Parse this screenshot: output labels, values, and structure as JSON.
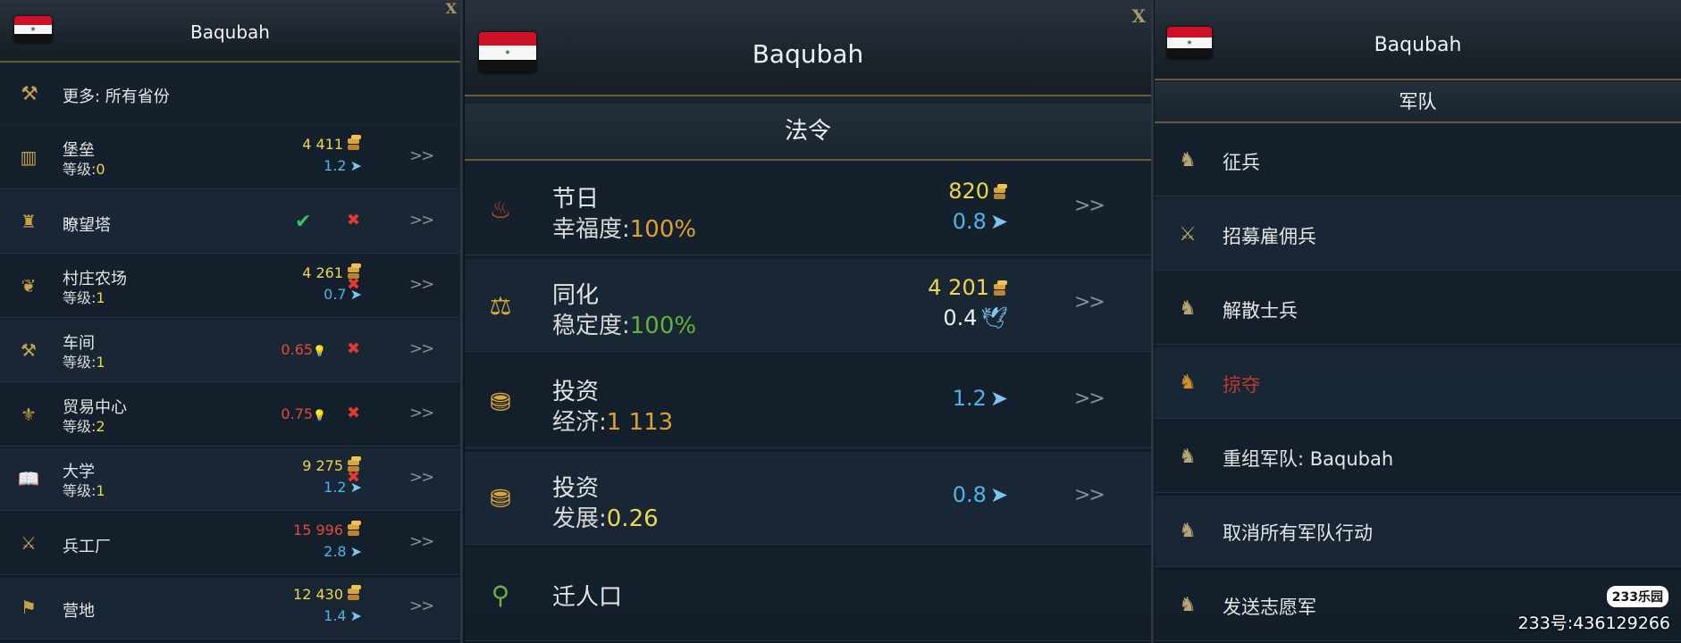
{
  "panel_left": {
    "title": "Baqubah",
    "close": "X",
    "more_link": "更多: 所有省份",
    "buildings": [
      {
        "name": "堡垒",
        "level_label": "等级:",
        "level": "0",
        "cost": "4 411",
        "cost_color": "gold",
        "rate": "1.2",
        "status": "none"
      },
      {
        "name": "瞭望塔",
        "level_label": "",
        "level": "",
        "cost": "",
        "cost_color": "",
        "rate": "",
        "status": "check"
      },
      {
        "name": "村庄农场",
        "level_label": "等级:",
        "level": "1",
        "cost": "4 261",
        "cost_color": "gold",
        "rate": "0.7",
        "status": "x"
      },
      {
        "name": "车间",
        "level_label": "等级:",
        "level": "1",
        "cost": "0.65",
        "cost_color": "red",
        "rate": "",
        "status": "x"
      },
      {
        "name": "贸易中心",
        "level_label": "等级:",
        "level": "2",
        "cost": "0.75",
        "cost_color": "red",
        "rate": "",
        "status": "x"
      },
      {
        "name": "大学",
        "level_label": "等级:",
        "level": "1",
        "cost": "9 275",
        "cost_color": "gold",
        "rate": "1.2",
        "status": "x"
      },
      {
        "name": "兵工厂",
        "level_label": "",
        "level": "",
        "cost": "15 996",
        "cost_color": "red",
        "rate": "2.8",
        "status": "none"
      },
      {
        "name": "营地",
        "level_label": "",
        "level": "",
        "cost": "12 430",
        "cost_color": "gold",
        "rate": "1.4",
        "status": "none"
      }
    ],
    "arrow": ">>"
  },
  "panel_mid": {
    "title": "Baqubah",
    "close": "X",
    "section": "法令",
    "decrees": [
      {
        "name": "节日",
        "stat_label": "幸福度:",
        "stat_value": "100%",
        "stat_color": "orange",
        "cost": "820",
        "rate": "0.8",
        "rate_color": "blue"
      },
      {
        "name": "同化",
        "stat_label": "稳定度:",
        "stat_value": "100%",
        "stat_color": "green",
        "cost": "4 201",
        "rate": "0.4",
        "rate_color": "white"
      },
      {
        "name": "投资",
        "stat_label": "经济:",
        "stat_value": "1 113",
        "stat_color": "orange",
        "cost": "",
        "rate": "1.2",
        "rate_color": "blue"
      },
      {
        "name": "投资",
        "stat_label": "发展:",
        "stat_value": "0.26",
        "stat_color": "gold",
        "cost": "",
        "rate": "0.8",
        "rate_color": "blue"
      },
      {
        "name": "迁人口",
        "stat_label": "",
        "stat_value": "",
        "stat_color": "",
        "cost": "",
        "rate": "",
        "rate_color": ""
      }
    ],
    "arrow": ">>"
  },
  "panel_right": {
    "title": "Baqubah",
    "section": "军队",
    "actions": [
      {
        "label": "征兵",
        "disabled": false
      },
      {
        "label": "招募雇佣兵",
        "disabled": false
      },
      {
        "label": "解散士兵",
        "disabled": false
      },
      {
        "label": "掠夺",
        "disabled": true
      },
      {
        "label": "重组军队: Baqubah",
        "disabled": false
      },
      {
        "label": "取消所有军队行动",
        "disabled": false
      },
      {
        "label": "发送志愿军",
        "disabled": false
      }
    ]
  },
  "watermark": {
    "logo": "233乐园",
    "text": "233号:436129266"
  },
  "colors": {
    "gold": "#f0d64a",
    "red": "#e44a3a",
    "blue": "#4fb3e6",
    "green": "#5fb33a",
    "accent_border": "#6b5a33"
  }
}
